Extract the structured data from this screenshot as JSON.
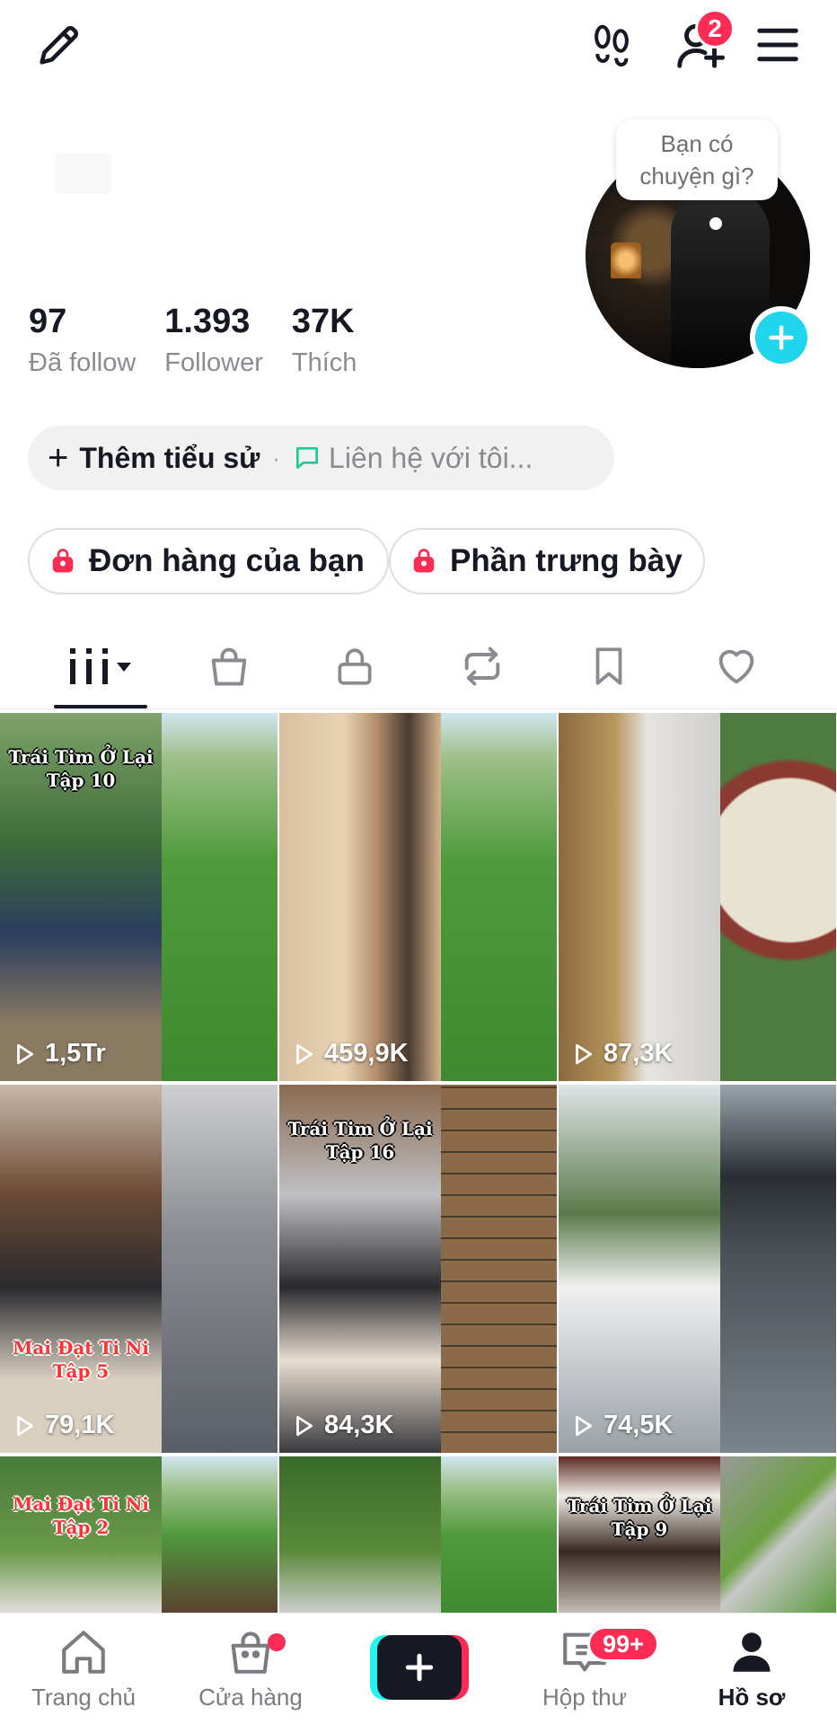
{
  "header": {
    "edit_icon": "pencil-icon",
    "footprint_icon": "footprint-icon",
    "add_friend_icon": "add-user-icon",
    "add_friend_badge": "2",
    "menu_icon": "hamburger-icon"
  },
  "profile": {
    "bubble_text": "Bạn có chuyện gì?",
    "stats": [
      {
        "value": "97",
        "label": "Đã follow"
      },
      {
        "value": "1.393",
        "label": "Follower"
      },
      {
        "value": "37K",
        "label": "Thích"
      }
    ],
    "bio": {
      "add_label": "Thêm tiểu sử",
      "separator": "·",
      "contact_label": "Liên hệ với tôi..."
    },
    "shop_pills": [
      {
        "label": "Đơn hàng của bạn"
      },
      {
        "label": "Phần trưng bày"
      }
    ]
  },
  "tabs": [
    {
      "icon": "grid-icon",
      "active": true
    },
    {
      "icon": "shopping-bag-icon"
    },
    {
      "icon": "lock-icon"
    },
    {
      "icon": "repost-icon"
    },
    {
      "icon": "bookmark-icon"
    },
    {
      "icon": "heart-icon"
    }
  ],
  "videos": [
    {
      "views": "1,5Tr",
      "overlay": "Trái Tim Ở Lại Tập 10"
    },
    {
      "views": "459,9K",
      "overlay": ""
    },
    {
      "views": "87,3K",
      "overlay": ""
    },
    {
      "views": "79,1K",
      "overlay": "Mai Đạt Ti Ni Tập 5"
    },
    {
      "views": "84,3K",
      "overlay": "Trái Tim Ở Lại Tập 16"
    },
    {
      "views": "74,5K",
      "overlay": ""
    },
    {
      "views": "",
      "overlay": "Mai Đạt Ti Ni Tập 2"
    },
    {
      "views": "",
      "overlay": ""
    },
    {
      "views": "",
      "overlay": "Trái Tim Ở Lại Tập 9"
    }
  ],
  "bottom_nav": [
    {
      "label": "Trang chủ",
      "icon": "home-icon"
    },
    {
      "label": "Cửa hàng",
      "icon": "shop-bag-icon"
    },
    {
      "label": "",
      "icon": "create-plus-icon"
    },
    {
      "label": "Hộp thư",
      "icon": "inbox-icon",
      "badge": "99+"
    },
    {
      "label": "Hồ sơ",
      "icon": "profile-icon",
      "active": true
    }
  ],
  "colors": {
    "accent_red": "#fe2c55",
    "accent_cyan": "#20d5ec",
    "text_primary": "#161823",
    "text_secondary": "#8a8b91"
  }
}
